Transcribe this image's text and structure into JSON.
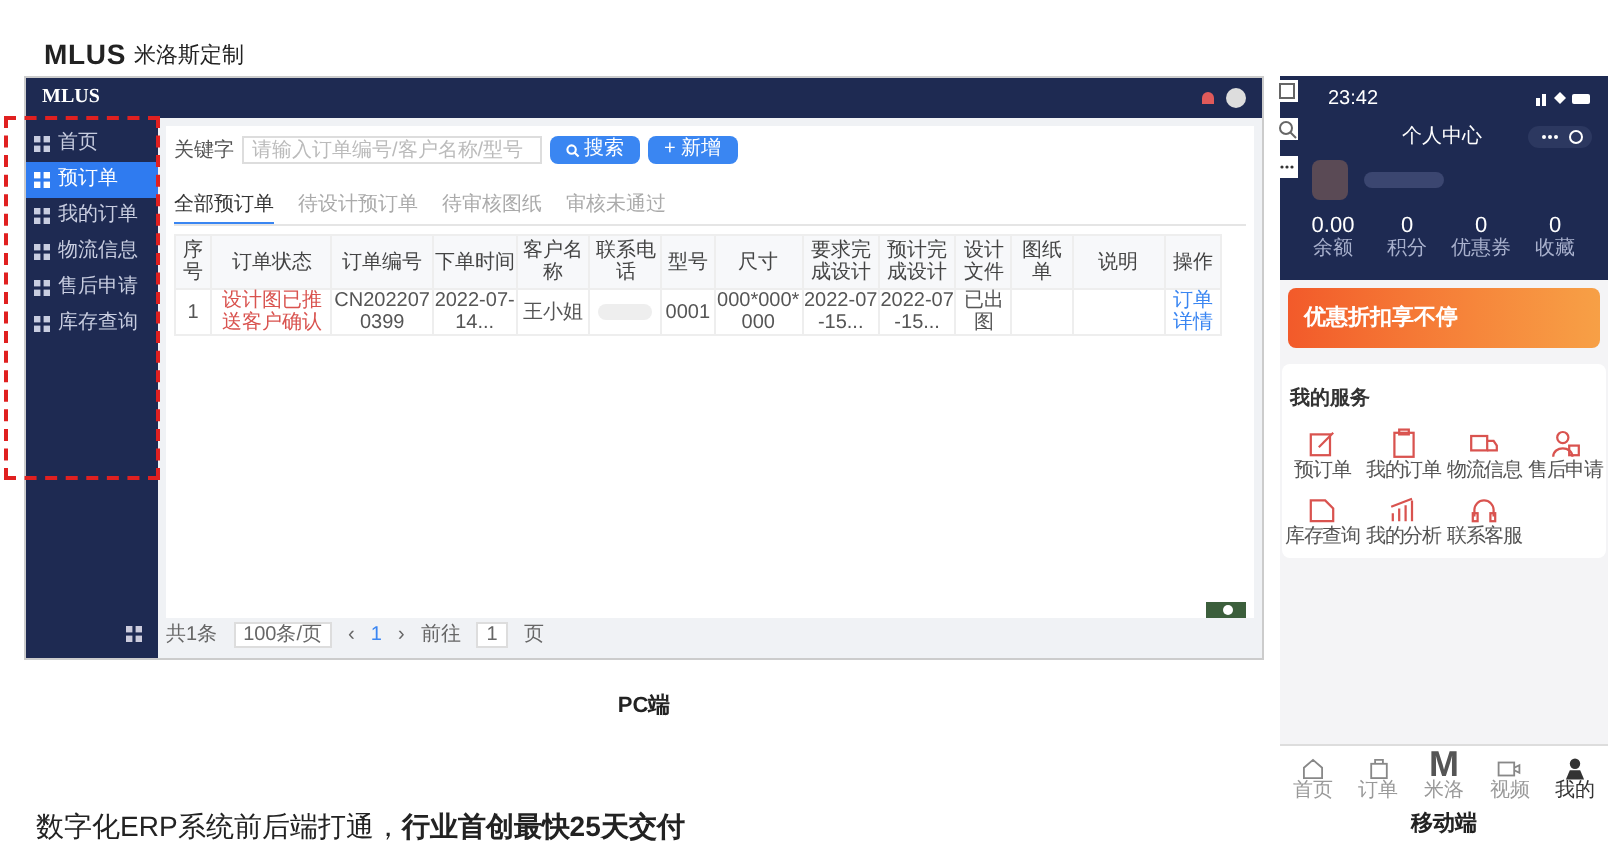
{
  "brand": {
    "logo": "MLUS",
    "name": "米洛斯定制"
  },
  "pc": {
    "logo": "MLUS",
    "sidebar": [
      {
        "label": "首页",
        "selected": false
      },
      {
        "label": "预订单",
        "selected": true
      },
      {
        "label": "我的订单",
        "selected": false
      },
      {
        "label": "物流信息",
        "selected": false
      },
      {
        "label": "售后申请",
        "selected": false
      },
      {
        "label": "库存查询",
        "selected": false
      }
    ],
    "search": {
      "label": "关键字",
      "placeholder": "请输入订单编号/客户名称/型号"
    },
    "buttons": [
      {
        "label": "搜索",
        "kind": "search"
      },
      {
        "label": "+ 新增",
        "kind": "add"
      }
    ],
    "tabs": [
      {
        "label": "全部预订单",
        "selected": true
      },
      {
        "label": "待设计预订单",
        "selected": false
      },
      {
        "label": "待审核图纸",
        "selected": false
      },
      {
        "label": "审核未通过",
        "selected": false
      }
    ],
    "table": {
      "columns": [
        "序号",
        "订单状态",
        "订单编号",
        "下单时间",
        "客户名称",
        "联系电话",
        "型号",
        "尺寸",
        "要求完成设计",
        "预计完成设计",
        "设计文件",
        "图纸单",
        "说明",
        "操作"
      ],
      "rows": [
        {
          "cells": [
            "1",
            "设计图已推送客户确认",
            "CN2022070399",
            "2022-07-14...",
            "王小姐",
            "",
            "0001",
            "000*000*000",
            "2022-07-15...",
            "2022-07-15...",
            "已出图",
            "",
            "",
            "订单详情"
          ]
        }
      ]
    },
    "pagination": {
      "total": "共1条",
      "page_size": "100条/页",
      "prev": "‹",
      "page": "1",
      "next": "›",
      "goto": "前往",
      "goto_value": "1",
      "unit": "页"
    },
    "caption": "PC端"
  },
  "mobile": {
    "time": "23:42",
    "title": "个人中心",
    "stats": [
      {
        "value": "0.00",
        "label": "余额"
      },
      {
        "value": "0",
        "label": "积分"
      },
      {
        "value": "0",
        "label": "优惠券"
      },
      {
        "value": "0",
        "label": "收藏"
      }
    ],
    "banner": "优惠折扣享不停",
    "services_title": "我的服务",
    "services": [
      {
        "label": "预订单",
        "kind": "edit"
      },
      {
        "label": "我的订单",
        "kind": "clipboard"
      },
      {
        "label": "物流信息",
        "kind": "truck"
      },
      {
        "label": "售后申请",
        "kind": "user"
      },
      {
        "label": "库存查询",
        "kind": "box"
      },
      {
        "label": "我的分析",
        "kind": "chart"
      },
      {
        "label": "联系客服",
        "kind": "headset"
      }
    ],
    "tabbar": [
      {
        "label": "首页",
        "kind": "home",
        "selected": false
      },
      {
        "label": "订单",
        "kind": "bag",
        "selected": false
      },
      {
        "label": "米洛",
        "kind": "logo",
        "logo": "M",
        "selected": false
      },
      {
        "label": "视频",
        "kind": "video",
        "selected": false
      },
      {
        "label": "我的",
        "kind": "user",
        "selected": true
      }
    ],
    "caption": "移动端"
  },
  "tagline": "数字化ERP系统前后端打通，**行业首创最快25天交付**"
}
